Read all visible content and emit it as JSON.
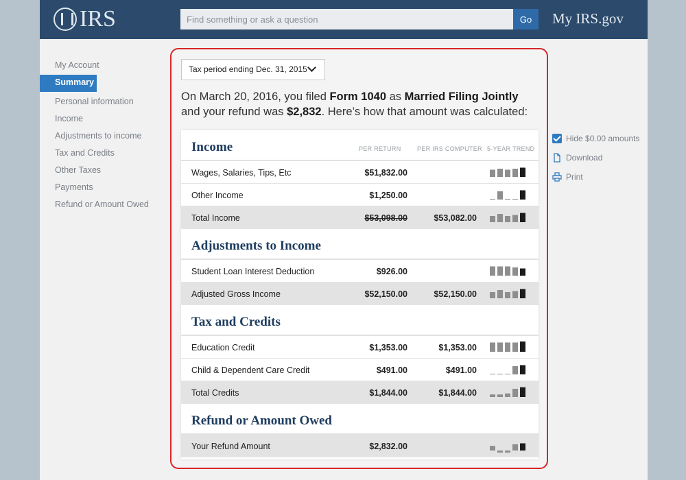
{
  "header": {
    "logo_text": "IRS",
    "search_placeholder": "Find something or ask a question",
    "go_label": "Go",
    "site_name": "My IRS.gov"
  },
  "sidebar": {
    "items": [
      {
        "label": "My Account",
        "active": false
      },
      {
        "label": "Summary",
        "active": true
      },
      {
        "label": "Personal information",
        "active": false
      },
      {
        "label": "Income",
        "active": false
      },
      {
        "label": "Adjustments to income",
        "active": false
      },
      {
        "label": "Tax and Credits",
        "active": false
      },
      {
        "label": "Other Taxes",
        "active": false
      },
      {
        "label": "Payments",
        "active": false
      },
      {
        "label": "Refund or Amount Owed",
        "active": false
      }
    ]
  },
  "main": {
    "period_selected": "Tax period ending Dec. 31, 2015",
    "summary": {
      "p1": "On March 20, 2016, you filed ",
      "form": "Form 1040",
      "p2": " as ",
      "status": "Married Filing Jointly",
      "p3": "and your refund was ",
      "refund": "$2,832",
      "p4": ". Here’s how that amount was calculated:"
    },
    "columns": {
      "per_return": "PER RETURN",
      "per_irs": "PER IRS COMPUTER",
      "trend": "5-YEAR TREND"
    },
    "sections": [
      {
        "title": "Income",
        "show_cols": true,
        "rows": [
          {
            "label": "Wages, Salaries, Tips, Etc",
            "per_return": "$51,832.00",
            "per_irs": "",
            "total": false,
            "strike": false,
            "trend": [
              0.7,
              0.8,
              0.7,
              0.8,
              0.9
            ]
          },
          {
            "label": "Other Income",
            "per_return": "$1,250.00",
            "per_irs": "",
            "total": false,
            "strike": false,
            "trend": [
              0.05,
              0.8,
              0.05,
              0.05,
              0.9
            ]
          },
          {
            "label": "Total Income",
            "per_return": "$53,098.00",
            "per_irs": "$53,082.00",
            "total": true,
            "strike": true,
            "trend": [
              0.6,
              0.8,
              0.6,
              0.7,
              0.9
            ]
          }
        ]
      },
      {
        "title": "Adjustments to Income",
        "show_cols": false,
        "rows": [
          {
            "label": "Student Loan Interest Deduction",
            "per_return": "$926.00",
            "per_irs": "",
            "total": false,
            "strike": false,
            "trend": [
              0.9,
              0.9,
              0.9,
              0.8,
              0.7
            ]
          },
          {
            "label": "Adjusted Gross Income",
            "per_return": "$52,150.00",
            "per_irs": "$52,150.00",
            "total": true,
            "strike": false,
            "trend": [
              0.6,
              0.8,
              0.6,
              0.7,
              0.9
            ]
          }
        ]
      },
      {
        "title": "Tax and Credits",
        "show_cols": false,
        "rows": [
          {
            "label": "Education Credit",
            "per_return": "$1,353.00",
            "per_irs": "$1,353.00",
            "total": false,
            "strike": false,
            "trend": [
              0.9,
              0.9,
              0.9,
              0.9,
              1.0
            ]
          },
          {
            "label": "Child & Dependent Care Credit",
            "per_return": "$491.00",
            "per_irs": "$491.00",
            "total": false,
            "strike": false,
            "trend": [
              0.05,
              0.05,
              0.05,
              0.8,
              0.9
            ]
          },
          {
            "label": "Total Credits",
            "per_return": "$1,844.00",
            "per_irs": "$1,844.00",
            "total": true,
            "strike": false,
            "trend": [
              0.25,
              0.25,
              0.35,
              0.8,
              0.95
            ]
          }
        ]
      },
      {
        "title": "Refund or Amount Owed",
        "show_cols": false,
        "rows": [
          {
            "label": "Your Refund Amount",
            "per_return": "$2,832.00",
            "per_irs": "",
            "total": true,
            "strike": false,
            "trend": [
              0.45,
              -0.3,
              -0.3,
              0.6,
              0.7
            ]
          }
        ]
      }
    ]
  },
  "actions": {
    "hide_zero": "Hide $0.00 amounts",
    "download": "Download",
    "print": "Print"
  },
  "colors": {
    "header": "#2b4a6c",
    "accent": "#2e7bc1",
    "heading": "#1f3d60",
    "highlight": "#d9252a"
  }
}
